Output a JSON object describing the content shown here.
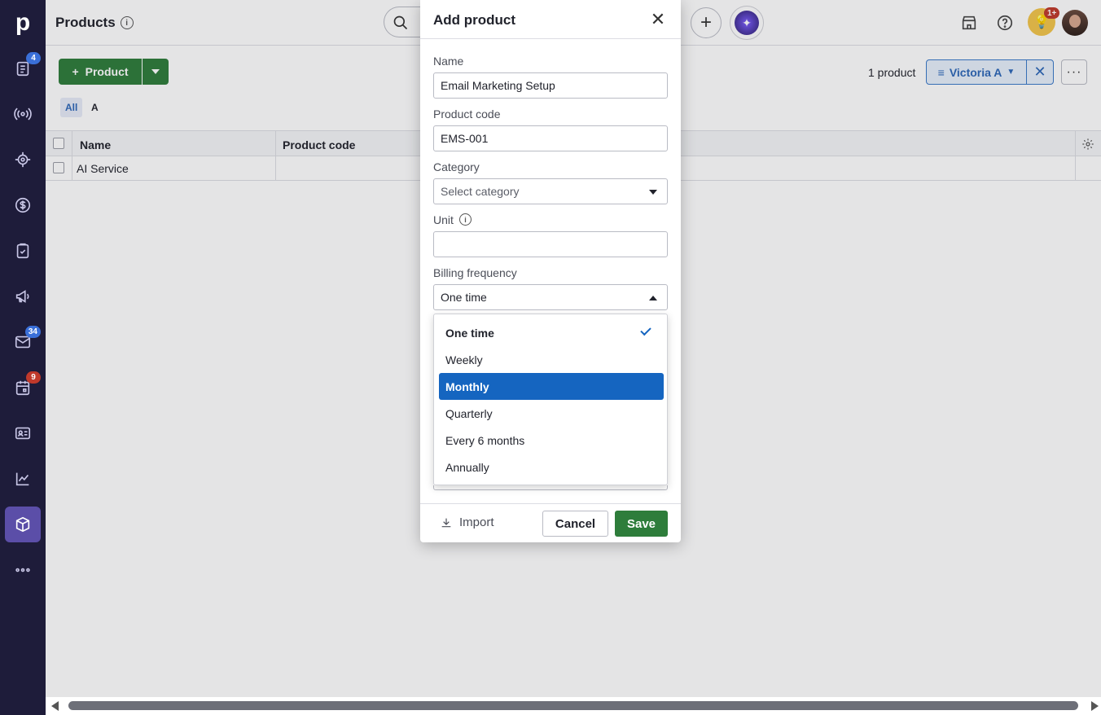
{
  "sidebar": {
    "logo": "p",
    "items": [
      {
        "name": "leads",
        "icon": "clipboard-list-icon",
        "badge": "4",
        "badge_color": "#3a6fd8"
      },
      {
        "name": "broadcast",
        "icon": "broadcast-icon"
      },
      {
        "name": "target",
        "icon": "target-icon"
      },
      {
        "name": "deals",
        "icon": "dollar-circle-icon"
      },
      {
        "name": "tasks",
        "icon": "clipboard-check-icon"
      },
      {
        "name": "campaigns",
        "icon": "megaphone-icon"
      },
      {
        "name": "mail",
        "icon": "mail-icon",
        "badge": "34",
        "badge_color": "#3a6fd8"
      },
      {
        "name": "calendar",
        "icon": "calendar-icon",
        "badge": "9",
        "badge_color": "#c0392b"
      },
      {
        "name": "contacts",
        "icon": "contact-card-icon"
      },
      {
        "name": "insights",
        "icon": "chart-line-icon"
      },
      {
        "name": "products",
        "icon": "box-icon",
        "active": true
      },
      {
        "name": "more",
        "icon": "more-horizontal-icon"
      }
    ]
  },
  "topbar": {
    "title": "Products",
    "bulb_badge": "1+"
  },
  "toolbar": {
    "add_label": "Product",
    "count_text": "1 product",
    "filter_label": "Victoria A",
    "more_label": "···"
  },
  "tabs": {
    "all": "All",
    "a": "A"
  },
  "table": {
    "headers": [
      "Name",
      "Product code"
    ],
    "rows": [
      {
        "name": "AI Service",
        "code": ""
      }
    ]
  },
  "modal": {
    "title": "Add product",
    "fields": {
      "name": {
        "label": "Name",
        "value": "Email Marketing Setup"
      },
      "code": {
        "label": "Product code",
        "value": "EMS-001"
      },
      "category": {
        "label": "Category",
        "placeholder": "Select category"
      },
      "unit": {
        "label": "Unit",
        "value": ""
      },
      "billing": {
        "label": "Billing frequency",
        "value": "One time"
      }
    },
    "billing_options": [
      {
        "label": "One time",
        "selected": true
      },
      {
        "label": "Weekly"
      },
      {
        "label": "Monthly",
        "highlighted": true
      },
      {
        "label": "Quarterly"
      },
      {
        "label": "Every 6 months"
      },
      {
        "label": "Annually"
      }
    ],
    "footer": {
      "import": "Import",
      "cancel": "Cancel",
      "save": "Save"
    }
  },
  "colors": {
    "sidebar_bg": "#1e1c3a",
    "primary_green": "#2e7d3b",
    "highlight_blue": "#1565c0",
    "filter_blue": "#2d67b8"
  }
}
